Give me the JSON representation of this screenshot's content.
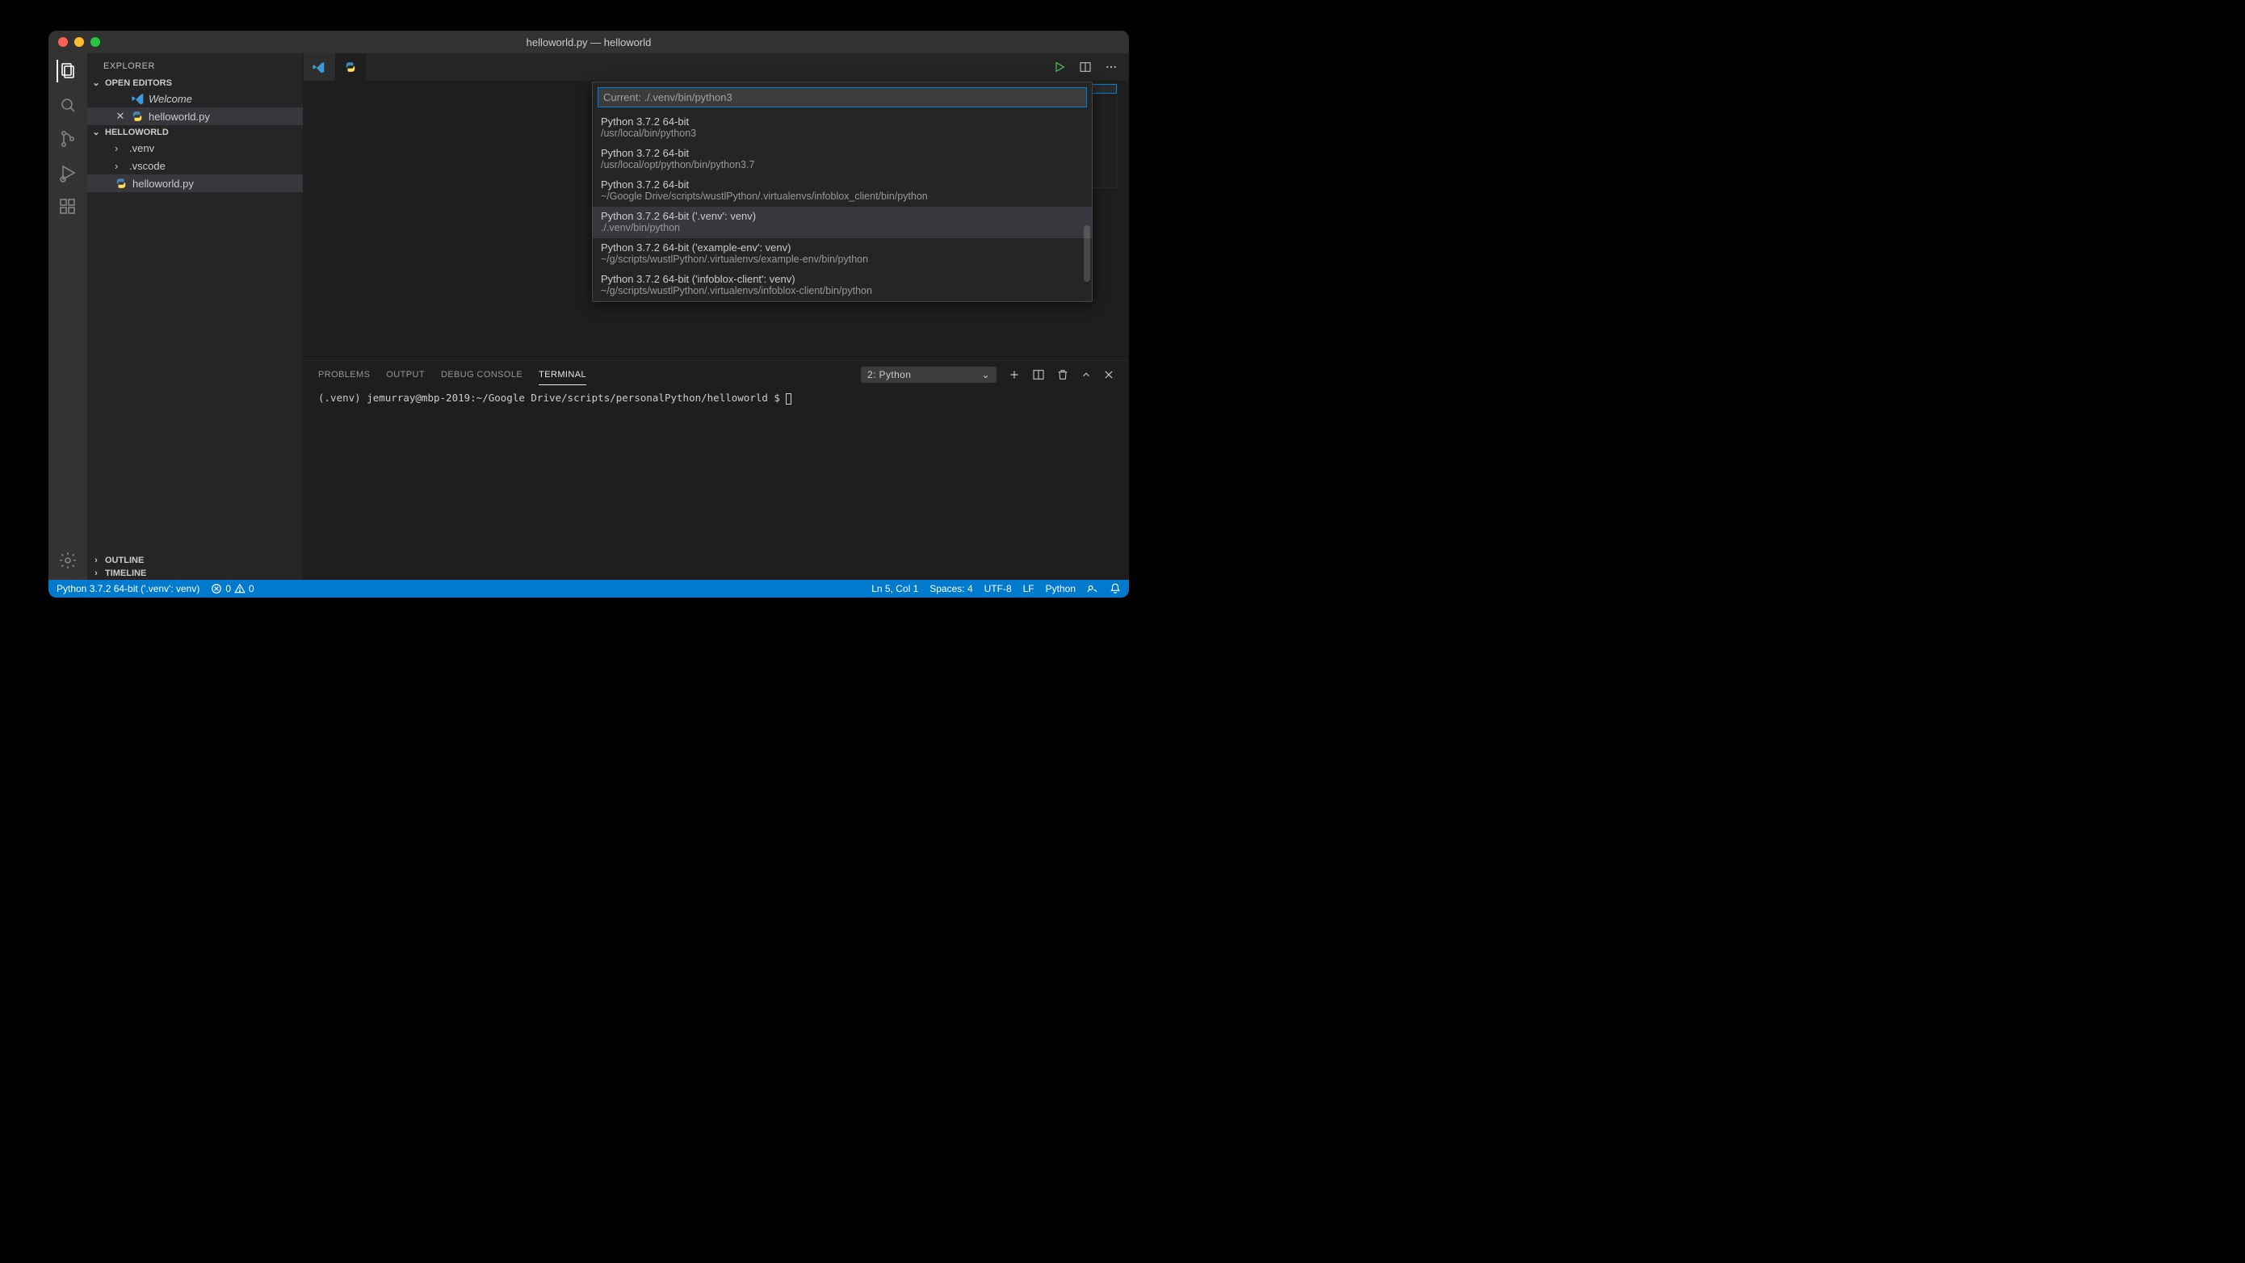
{
  "window": {
    "title": "helloworld.py — helloworld"
  },
  "sidebar": {
    "title": "EXPLORER",
    "openEditors": {
      "label": "OPEN EDITORS",
      "items": [
        {
          "label": "Welcome",
          "italic": true
        },
        {
          "label": "helloworld.py"
        }
      ]
    },
    "folder": {
      "label": "HELLOWORLD",
      "items": [
        {
          "label": ".venv"
        },
        {
          "label": ".vscode"
        },
        {
          "label": "helloworld.py"
        }
      ]
    },
    "outline": "OUTLINE",
    "timeline": "TIMELINE"
  },
  "tabs": {
    "actions": {
      "run": "Run",
      "split": "Split",
      "more": "More"
    }
  },
  "quickpick": {
    "placeholder": "Current: ./.venv/bin/python3",
    "items": [
      {
        "label": "Python 3.7.2 64-bit",
        "desc": "/usr/local/bin/python3"
      },
      {
        "label": "Python 3.7.2 64-bit",
        "desc": "/usr/local/opt/python/bin/python3.7"
      },
      {
        "label": "Python 3.7.2 64-bit",
        "desc": "~/Google Drive/scripts/wustlPython/.virtualenvs/infoblox_client/bin/python"
      },
      {
        "label": "Python 3.7.2 64-bit ('.venv': venv)",
        "desc": "./.venv/bin/python"
      },
      {
        "label": "Python 3.7.2 64-bit ('example-env': venv)",
        "desc": "~/g/scripts/wustlPython/.virtualenvs/example-env/bin/python"
      },
      {
        "label": "Python 3.7.2 64-bit ('infoblox-client': venv)",
        "desc": "~/g/scripts/wustlPython/.virtualenvs/infoblox-client/bin/python"
      }
    ]
  },
  "panel": {
    "tabs": {
      "problems": "PROBLEMS",
      "output": "OUTPUT",
      "debug": "DEBUG CONSOLE",
      "terminal": "TERMINAL"
    },
    "terminalSelect": "2: Python",
    "terminalLine": "(.venv) jemurray@mbp-2019:~/Google Drive/scripts/personalPython/helloworld $ "
  },
  "status": {
    "interpreter": "Python 3.7.2 64-bit ('.venv': venv)",
    "errors": "0",
    "warnings": "0",
    "lncol": "Ln 5, Col 1",
    "spaces": "Spaces: 4",
    "encoding": "UTF-8",
    "eol": "LF",
    "lang": "Python"
  }
}
